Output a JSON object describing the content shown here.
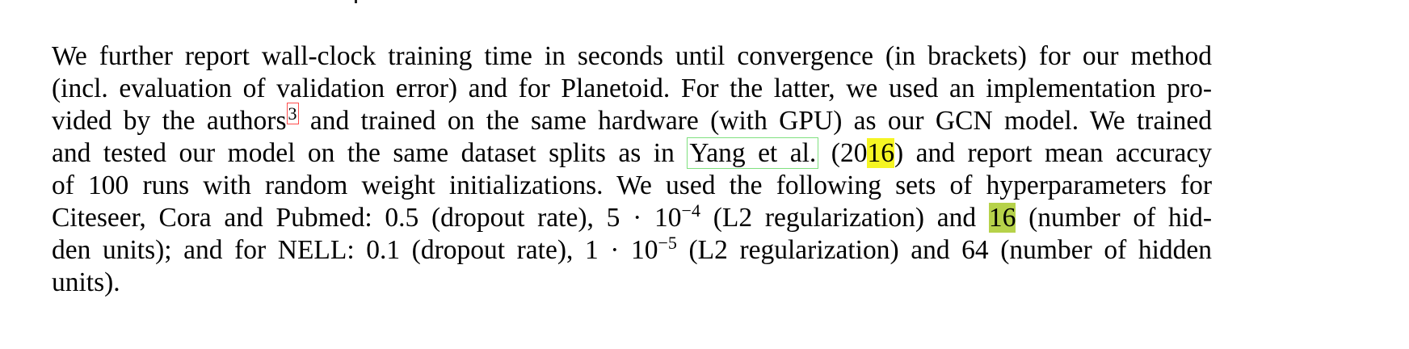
{
  "paragraph": {
    "l1": "We further report wall-clock training time in seconds until convergence (in brackets) for our method",
    "l2": "(incl. evaluation of validation error) and for Planetoid. For the latter, we used an implementation pro-",
    "l3_a": "vided by the authors",
    "l3_fn": "3",
    "l3_b": " and trained on the same hardware (with GPU) as our GCN model. We trained",
    "l4_a": "and tested our model on the same dataset splits as in ",
    "l4_cite": "Yang et al.",
    "l4_b": " (20",
    "l4_year_hl": "16",
    "l4_c": ") and report mean accuracy",
    "l5": "of 100 runs with random weight initializations. We used the following sets of hyperparameters for",
    "l6_a": "Citeseer, Cora and Pubmed: 0.5 (dropout rate), 5 · 10",
    "l6_exp": "−4",
    "l6_b": " (L2 regularization) and ",
    "l6_hl": "16",
    "l6_c": " (number of hid-",
    "l7_a": "den units); and for NELL: 0.1 (dropout rate), 1 · 10",
    "l7_exp": "−5",
    "l7_b": " (L2 regularization) and 64 (number of hidden",
    "l8": "units)."
  },
  "colors": {
    "citation_box": "#7fe07f",
    "footnote_box": "#ff4d4d",
    "highlight_yellow": "#f5f523",
    "highlight_green": "#b6d24a"
  }
}
